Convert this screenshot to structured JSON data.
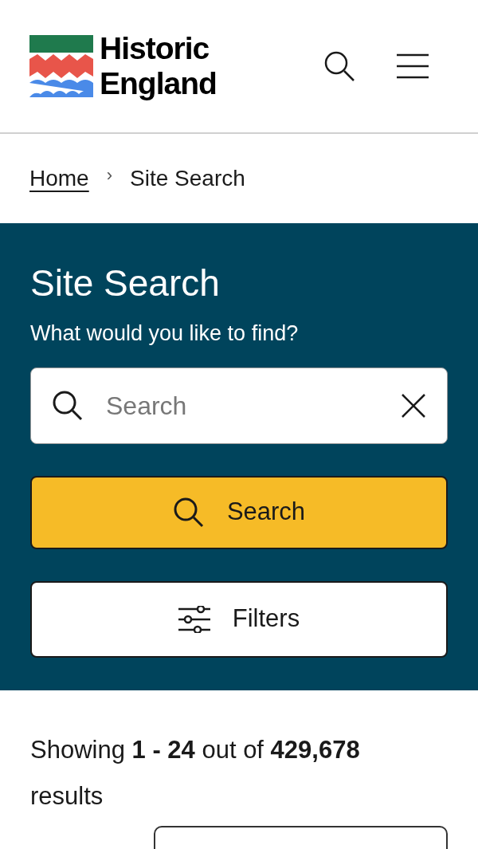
{
  "header": {
    "logo_text": [
      "Historic",
      "England"
    ]
  },
  "breadcrumb": [
    {
      "label": "Home",
      "kind": "link"
    },
    {
      "label": "›",
      "kind": "separator"
    },
    {
      "label": "Site Search",
      "kind": "current"
    }
  ],
  "search_panel": {
    "title": "Site Search",
    "prompt": "What would you like to find?",
    "search": {
      "placeholder": "Search"
    },
    "search_button": "Search",
    "filters_button": "Filters"
  },
  "results": {
    "summary": "Showing **1 - 24** out of **429,678** results"
  }
}
